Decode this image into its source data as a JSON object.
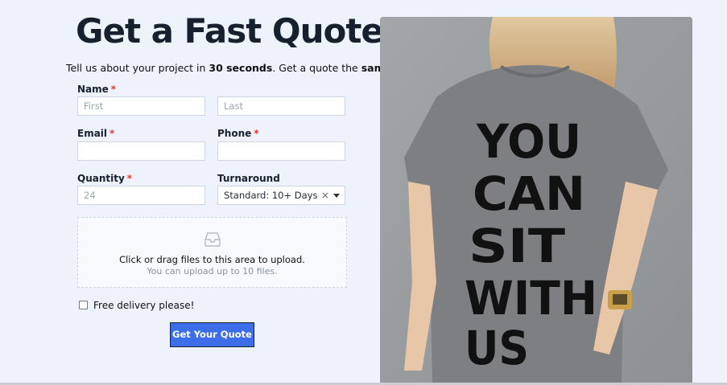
{
  "header": {
    "title": "Get a Fast Quote",
    "subtitle_prefix": "Tell us about your project in ",
    "subtitle_bold1": "30 seconds",
    "subtitle_middle": ". Get a quote the ",
    "subtitle_bold2": "same day",
    "subtitle_suffix": "."
  },
  "form": {
    "name_label": "Name",
    "first_placeholder": "First",
    "last_placeholder": "Last",
    "email_label": "Email",
    "email_value": "",
    "phone_label": "Phone",
    "phone_value": "",
    "quantity_label": "Quantity",
    "quantity_placeholder": "24",
    "turnaround_label": "Turnaround",
    "turnaround_value": "Standard: 10+ Days",
    "required_mark": "*",
    "clear_glyph": "×"
  },
  "upload": {
    "icon": "inbox-icon",
    "main_text": "Click or drag files to this area to upload.",
    "hint_text": "You can upload up to 10 files."
  },
  "delivery": {
    "label": "Free delivery please!",
    "checked": false
  },
  "submit": {
    "label": "Get Your Quote"
  },
  "photo": {
    "shirt_text": "YOU CAN SIT WITH US"
  },
  "colors": {
    "background": "#eef2fb",
    "accent": "#3b6ee8",
    "required": "#e53935",
    "heading": "#16202e"
  }
}
